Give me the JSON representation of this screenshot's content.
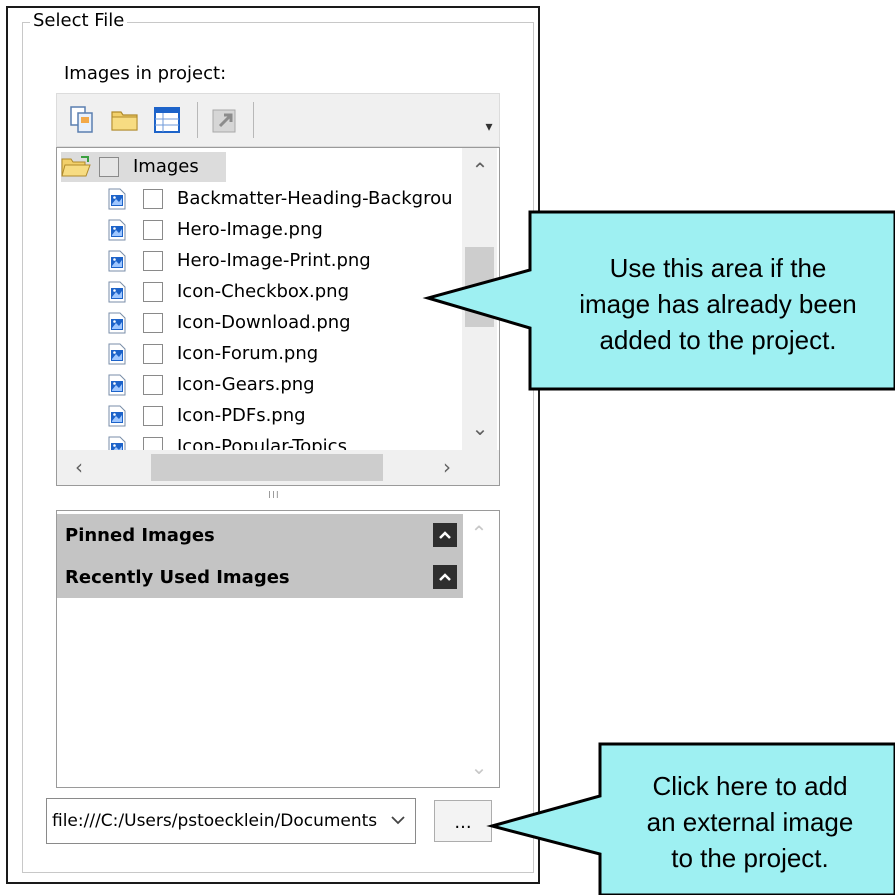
{
  "group": {
    "title": "Select File"
  },
  "images_label": "Images in project:",
  "toolbar": {
    "buttons": [
      {
        "icon": "copy-icon"
      },
      {
        "icon": "folder-icon"
      },
      {
        "icon": "grid-view-icon"
      },
      {
        "icon": "upload-icon",
        "disabled": true
      }
    ]
  },
  "tree": {
    "root": {
      "label": "Images"
    },
    "items": [
      {
        "label": "Backmatter-Heading-Backgrou"
      },
      {
        "label": "Hero-Image.png"
      },
      {
        "label": "Hero-Image-Print.png"
      },
      {
        "label": "Icon-Checkbox.png"
      },
      {
        "label": "Icon-Download.png"
      },
      {
        "label": "Icon-Forum.png"
      },
      {
        "label": "Icon-Gears.png"
      },
      {
        "label": "Icon-PDFs.png"
      },
      {
        "label": "Icon-Popular-Topics"
      }
    ]
  },
  "lower_panel": {
    "sections": [
      {
        "title": "Pinned Images"
      },
      {
        "title": "Recently Used Images"
      }
    ]
  },
  "path_field": {
    "value": "file:///C:/Users/pstoecklein/Documents"
  },
  "browse_button": {
    "label": "..."
  },
  "callouts": {
    "top": {
      "lines": [
        "Use this area if the",
        "image has already been",
        "added to the project."
      ]
    },
    "bottom": {
      "lines": [
        "Click here to add",
        "an external image",
        "to the project."
      ]
    }
  },
  "colors": {
    "callout_fill": "#9ef0f2",
    "callout_stroke": "#000000",
    "icon_blue": "#1d63c9",
    "folder_yellow": "#f2d06b"
  }
}
